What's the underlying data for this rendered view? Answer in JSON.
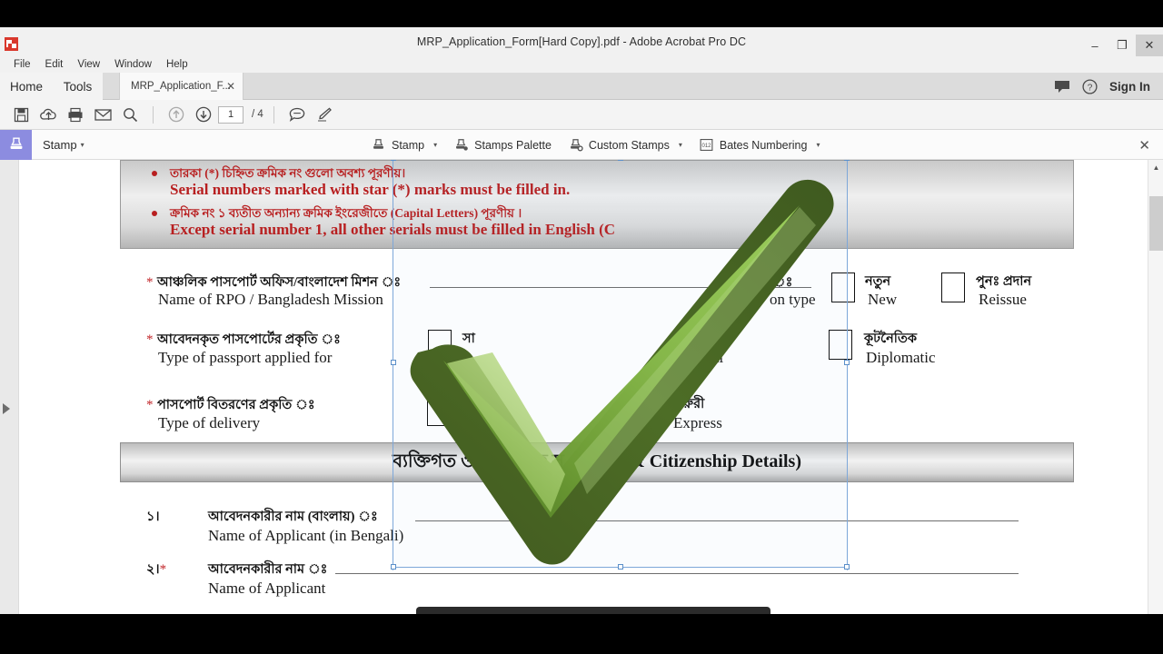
{
  "window": {
    "title": "MRP_Application_Form[Hard Copy].pdf - Adobe Acrobat Pro DC",
    "app_icon": "acrobat-icon",
    "minimize": "–",
    "restore": "❐",
    "close": "✕"
  },
  "menubar": {
    "items": [
      {
        "label": "File"
      },
      {
        "label": "Edit"
      },
      {
        "label": "View"
      },
      {
        "label": "Window"
      },
      {
        "label": "Help"
      }
    ]
  },
  "tabstrip": {
    "home": "Home",
    "tools": "Tools",
    "document_tab": "MRP_Application_F...",
    "document_tab_close": "✕",
    "comment_icon": "comment-bubble-icon",
    "help_icon": "help-circle-icon",
    "sign_in": "Sign In"
  },
  "toolbar": {
    "buttons": [
      {
        "name": "save-button",
        "icon": "floppy-disk-icon"
      },
      {
        "name": "upload-button",
        "icon": "cloud-upload-icon"
      },
      {
        "name": "print-button",
        "icon": "printer-icon"
      },
      {
        "name": "email-button",
        "icon": "envelope-icon"
      },
      {
        "name": "search-button",
        "icon": "magnifier-icon"
      },
      {
        "name": "previous-page-button",
        "icon": "arrow-up-circle-icon"
      },
      {
        "name": "next-page-button",
        "icon": "arrow-down-circle-icon"
      }
    ],
    "page_number": "1",
    "page_total": "/ 4",
    "comment_tool_icon": "speech-bubble-icon",
    "highlight_tool_icon": "highlighter-pen-icon"
  },
  "stampbar": {
    "swatch_icon": "stamp-icon",
    "panel_label": "Stamp",
    "panel_caret": "▾",
    "tools": [
      {
        "name": "stamp-tool",
        "label": "Stamp",
        "icon": "stamp-icon",
        "caret": "▾"
      },
      {
        "name": "stamps-palette-tool",
        "label": "Stamps Palette",
        "icon": "stamp-palette-icon",
        "caret": ""
      },
      {
        "name": "custom-stamps-tool",
        "label": "Custom Stamps",
        "icon": "stamp-gear-icon",
        "caret": "▾"
      },
      {
        "name": "bates-numbering-tool",
        "label": "Bates Numbering",
        "icon": "bates-012-icon",
        "caret": "▾"
      }
    ],
    "close": "✕"
  },
  "viewport": {
    "left_rail_toggle_icon": "expand-panel-arrow-icon",
    "scroll_up_icon": "scroll-up-arrow-icon"
  },
  "document": {
    "notice": {
      "bullet1_bn": "তারকা (*) চিহ্নিত ক্রমিক নং গুলো  অবশ্য পূরণীয়।",
      "bullet1_en": "Serial numbers marked with star (*) marks must be filled in.",
      "bullet2_bn": "ক্রমিক নং ১ ব্যতীত অন্যান্য ক্রমিক  ইংরেজীতে (Capital Letters) পূরণীয় ।",
      "bullet2_en": "Except serial number 1, all other serials must be filled in English  (C"
    },
    "rows": [
      {
        "star": "*",
        "bn": "আঞ্চলিক পাসপোর্ট অফিস/বাংলাদেশ মিশন ঃ",
        "en": "Name of RPO / Bangladesh Mission"
      },
      {
        "star": "*",
        "bn": "আবেদনকৃত পাসপোর্টের প্রকৃতি ঃ",
        "en": "Type of passport applied for"
      },
      {
        "star": "*",
        "bn": "পাসপোর্ট বিতরণের প্রকৃতি ঃ",
        "en": "Type of delivery"
      }
    ],
    "application_type": {
      "bn_partial": "ঃ",
      "en_partial": "on type",
      "options": [
        {
          "bn": "নতুন",
          "en": "New",
          "checked": false
        },
        {
          "bn": "পুনঃ প্রদান",
          "en": "Reissue",
          "checked": false
        }
      ]
    },
    "passport_type_options": [
      {
        "bn": "সা",
        "en": "",
        "checked": false
      },
      {
        "bn": "াল",
        "en": "fficial",
        "checked": false
      },
      {
        "bn": "কূটনৈতিক",
        "en": "Diplomatic",
        "checked": false
      }
    ],
    "delivery_options": [
      {
        "bn": "",
        "en": "",
        "checked": false
      },
      {
        "bn": "জরুরী",
        "en": "Express",
        "checked": false
      }
    ],
    "section_title": "ব্যক্তিগত ও নাগরিকত্ব স    ersonal & Citizenship Details)",
    "numbered_rows": [
      {
        "num": "১।",
        "star": "",
        "bn": "আবেদনকারীর নাম (বাংলায়) ঃ",
        "en": "Name of Applicant (in Bengali)"
      },
      {
        "num": "২।",
        "star": "*",
        "bn": "আবেদনকারীর নাম ঃ",
        "en": "Name of Applicant"
      }
    ],
    "stamp": {
      "name": "green-check-stamp",
      "color_light": "#9fd35a",
      "color_mid": "#64a13a",
      "color_dark": "#4b6b25",
      "selected": true
    }
  }
}
